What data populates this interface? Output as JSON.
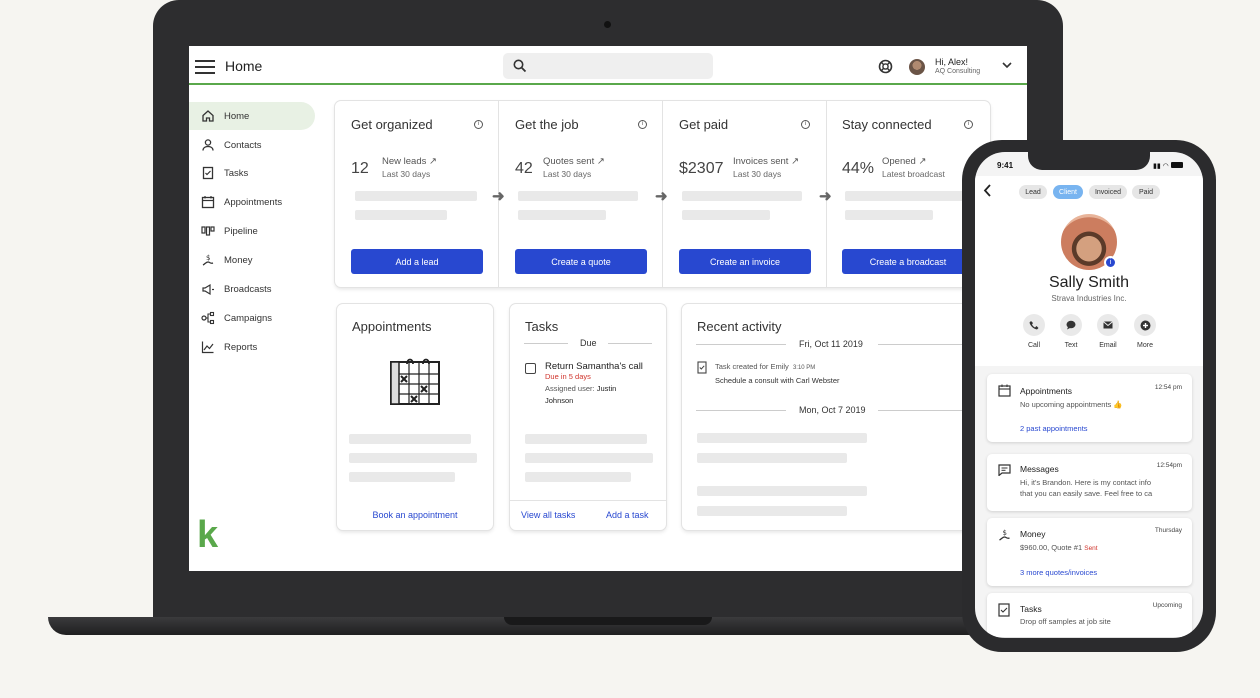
{
  "header": {
    "title": "Home",
    "greeting": "Hi, Alex!",
    "company": "AQ Consulting"
  },
  "sidebar": {
    "items": [
      {
        "label": "Home",
        "icon": "home-icon"
      },
      {
        "label": "Contacts",
        "icon": "person-icon"
      },
      {
        "label": "Tasks",
        "icon": "checklist-icon"
      },
      {
        "label": "Appointments",
        "icon": "calendar-icon"
      },
      {
        "label": "Pipeline",
        "icon": "pipeline-icon"
      },
      {
        "label": "Money",
        "icon": "money-icon"
      },
      {
        "label": "Broadcasts",
        "icon": "megaphone-icon"
      },
      {
        "label": "Campaigns",
        "icon": "campaigns-icon"
      },
      {
        "label": "Reports",
        "icon": "chart-icon"
      }
    ],
    "logo": "k"
  },
  "steps": [
    {
      "title": "Get organized",
      "value": "12",
      "label": "New leads",
      "sub": "Last 30 days",
      "button": "Add a lead"
    },
    {
      "title": "Get the job",
      "value": "42",
      "label": "Quotes sent",
      "sub": "Last 30 days",
      "button": "Create a quote"
    },
    {
      "title": "Get paid",
      "value": "$2307",
      "label": "Invoices sent",
      "sub": "Last 30 days",
      "button": "Create an invoice"
    },
    {
      "title": "Stay connected",
      "value": "44%",
      "label": "Opened",
      "sub": "Latest broadcast",
      "button": "Create a broadcast"
    }
  ],
  "appointments": {
    "title": "Appointments",
    "link": "Book an appointment"
  },
  "tasks": {
    "title": "Tasks",
    "section": "Due",
    "item": "Return Samantha's call",
    "due": "Due in 5 days",
    "assigned_label": "Assigned user:",
    "assigned_name": "Justin",
    "assigned_last": "Johnson",
    "link_all": "View all tasks",
    "link_add": "Add a task"
  },
  "activity": {
    "title": "Recent activity",
    "date1": "Fri, Oct 11 2019",
    "item_title": "Task created for Emily",
    "item_time": "3:10 PM",
    "item_desc": "Schedule a consult with Carl Webster",
    "date2": "Mon, Oct 7 2019"
  },
  "phone": {
    "time": "9:41",
    "stages": [
      "Lead",
      "Client",
      "Invoiced",
      "Paid"
    ],
    "name": "Sally Smith",
    "company": "Strava Industries Inc.",
    "actions": [
      "Call",
      "Text",
      "Email",
      "More"
    ],
    "cards": [
      {
        "title": "Appointments",
        "time": "12:54 pm",
        "desc": "No upcoming appointments",
        "link": "2 past appointments"
      },
      {
        "title": "Messages",
        "time": "12:54pm",
        "desc1": "Hi, it's Brandon. Here is my contact info",
        "desc2": "that you can easily save. Feel free to ca"
      },
      {
        "title": "Money",
        "time": "Thursday",
        "desc": "$960.00,  Quote #1",
        "status": "Sent",
        "link": "3 more quotes/invoices"
      },
      {
        "title": "Tasks",
        "time": "Upcoming",
        "desc": "Drop off samples at job site"
      }
    ]
  },
  "colors": {
    "accent": "#2848d0",
    "brand_green": "#5aa84b",
    "due_red": "#d0342c"
  }
}
